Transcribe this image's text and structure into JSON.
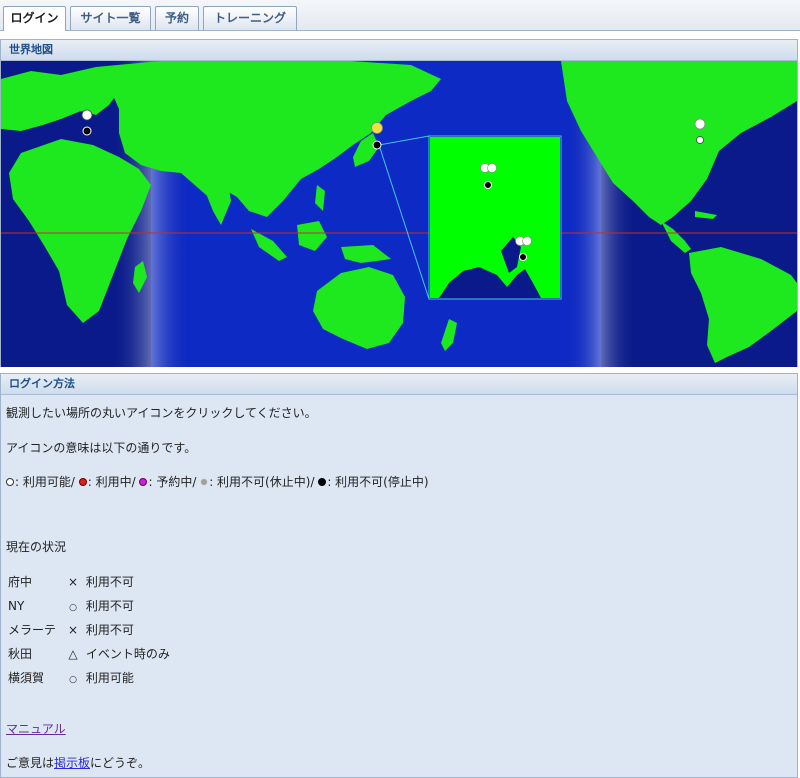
{
  "tabs": [
    {
      "label": "ログイン",
      "active": true
    },
    {
      "label": "サイト一覧",
      "active": false
    },
    {
      "label": "予約",
      "active": false
    },
    {
      "label": "トレーニング",
      "active": false
    }
  ],
  "map_panel": {
    "title": "世界地図"
  },
  "login_panel": {
    "title": "ログイン方法",
    "instruction": "観測したい場所の丸いアイコンをクリックしてください。",
    "icon_meaning": "アイコンの意味は以下の通りです。",
    "legend": [
      {
        "text": ": 利用可能",
        "color": "#ffffff",
        "sep": " / "
      },
      {
        "text": ": 利用中",
        "color": "#e02020",
        "sep": " / "
      },
      {
        "text": ": 予約中",
        "color": "#d020d0",
        "sep": " / "
      },
      {
        "text": ": 利用不可(休止中)",
        "color": "#a0a0a0",
        "sep": " / "
      },
      {
        "text": ": 利用不可(停止中)",
        "color": "#000000",
        "sep": ""
      }
    ],
    "status_heading": "現在の状況",
    "status": [
      {
        "name": "府中",
        "mark": "×",
        "text": "利用不可"
      },
      {
        "name": "NY",
        "mark": "○",
        "text": "利用不可"
      },
      {
        "name": "メラーテ",
        "mark": "×",
        "text": "利用不可"
      },
      {
        "name": "秋田",
        "mark": "△",
        "text": "イベント時のみ"
      },
      {
        "name": "横須賀",
        "mark": "○",
        "text": "利用可能"
      }
    ],
    "manual_link": "マニュアル",
    "feedback_prefix": "ご意見は",
    "feedback_link": "掲示板",
    "feedback_suffix": "にどうぞ。"
  },
  "colors": {
    "ocean": "#0a1a8a",
    "land": "#1ee81e",
    "inset_land": "#00ff00",
    "equator": "#c03030"
  }
}
